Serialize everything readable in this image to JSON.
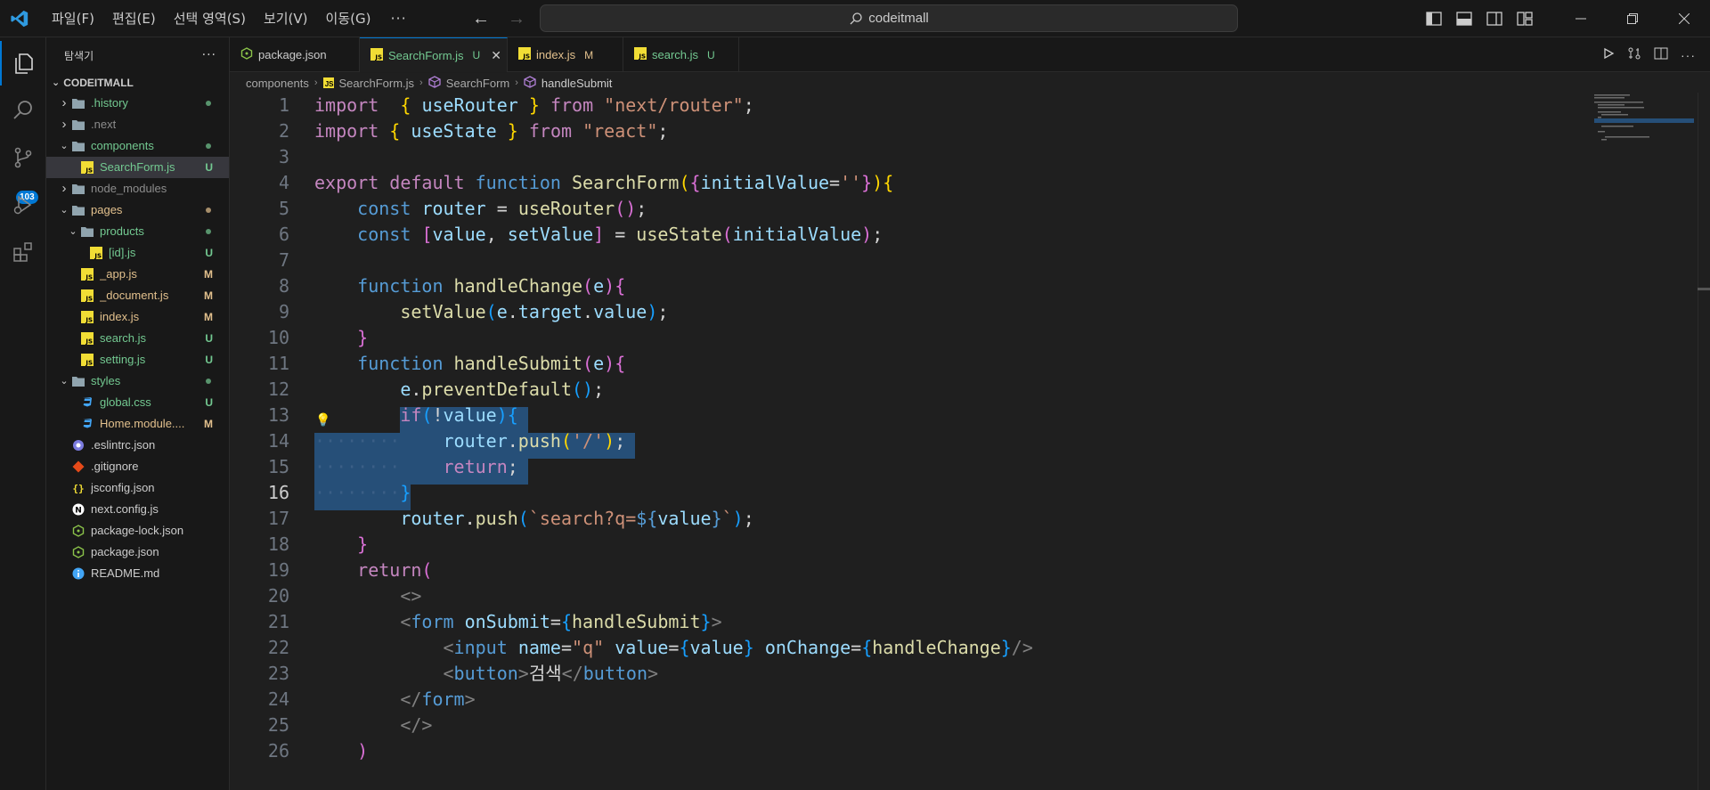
{
  "titlebar": {
    "menu": [
      "파일(F)",
      "편집(E)",
      "선택 영역(S)",
      "보기(V)",
      "이동(G)"
    ],
    "more": "···",
    "search": "codeitmall",
    "nav_back": "←",
    "nav_forward": "→"
  },
  "activity": {
    "scm_badge": "103"
  },
  "sidebar": {
    "title": "탐색기",
    "more": "···",
    "root": "CODEITMALL",
    "items": [
      {
        "label": ".history",
        "kind": "folder",
        "depth": 0,
        "open": false,
        "status": "dot",
        "color": "#73c991"
      },
      {
        "label": ".next",
        "kind": "folder",
        "depth": 0,
        "open": false,
        "status": "",
        "color": "#8c8c8c"
      },
      {
        "label": "components",
        "kind": "folder",
        "depth": 0,
        "open": true,
        "status": "dot",
        "color": "#73c991"
      },
      {
        "label": "SearchForm.js",
        "kind": "js",
        "depth": 1,
        "status": "U",
        "color": "#73c991",
        "selected": true
      },
      {
        "label": "node_modules",
        "kind": "folder",
        "depth": 0,
        "open": false,
        "status": "",
        "color": "#8c8c8c"
      },
      {
        "label": "pages",
        "kind": "folder",
        "depth": 0,
        "open": true,
        "status": "dot",
        "color": "#e2c08d"
      },
      {
        "label": "products",
        "kind": "folder",
        "depth": 1,
        "open": true,
        "status": "dot",
        "color": "#73c991"
      },
      {
        "label": "[id].js",
        "kind": "js",
        "depth": 2,
        "status": "U",
        "color": "#73c991"
      },
      {
        "label": "_app.js",
        "kind": "js",
        "depth": 1,
        "status": "M",
        "color": "#e2c08d"
      },
      {
        "label": "_document.js",
        "kind": "js",
        "depth": 1,
        "status": "M",
        "color": "#e2c08d"
      },
      {
        "label": "index.js",
        "kind": "js",
        "depth": 1,
        "status": "M",
        "color": "#e2c08d"
      },
      {
        "label": "search.js",
        "kind": "js",
        "depth": 1,
        "status": "U",
        "color": "#73c991"
      },
      {
        "label": "setting.js",
        "kind": "js",
        "depth": 1,
        "status": "U",
        "color": "#73c991"
      },
      {
        "label": "styles",
        "kind": "folder",
        "depth": 0,
        "open": true,
        "status": "dot",
        "color": "#73c991"
      },
      {
        "label": "global.css",
        "kind": "css",
        "depth": 1,
        "status": "U",
        "color": "#73c991"
      },
      {
        "label": "Home.module....",
        "kind": "css",
        "depth": 1,
        "status": "M",
        "color": "#e2c08d"
      },
      {
        "label": ".eslintrc.json",
        "kind": "eslint",
        "depth": 0,
        "status": "",
        "color": "#cccccc"
      },
      {
        "label": ".gitignore",
        "kind": "git",
        "depth": 0,
        "status": "",
        "color": "#cccccc"
      },
      {
        "label": "jsconfig.json",
        "kind": "json",
        "depth": 0,
        "status": "",
        "color": "#cccccc"
      },
      {
        "label": "next.config.js",
        "kind": "next",
        "depth": 0,
        "status": "",
        "color": "#cccccc"
      },
      {
        "label": "package-lock.json",
        "kind": "npm",
        "depth": 0,
        "status": "",
        "color": "#cccccc"
      },
      {
        "label": "package.json",
        "kind": "npm",
        "depth": 0,
        "status": "",
        "color": "#cccccc"
      },
      {
        "label": "README.md",
        "kind": "info",
        "depth": 0,
        "status": "",
        "color": "#cccccc"
      }
    ]
  },
  "tabs": [
    {
      "label": "package.json",
      "kind": "npm",
      "status": "",
      "color": "#cccccc",
      "active": false
    },
    {
      "label": "SearchForm.js",
      "kind": "js",
      "status": "U",
      "color": "#73c991",
      "active": true
    },
    {
      "label": "index.js",
      "kind": "js",
      "status": "M",
      "color": "#e2c08d",
      "active": false
    },
    {
      "label": "search.js",
      "kind": "js",
      "status": "U",
      "color": "#73c991",
      "active": false
    }
  ],
  "breadcrumb": {
    "folder": "components",
    "file": "SearchForm.js",
    "symbol1": "SearchForm",
    "symbol2": "handleSubmit"
  },
  "editor": {
    "current_line": 16,
    "lines": [
      [
        [
          "kw",
          "import"
        ],
        [
          "",
          "  "
        ],
        [
          "b1",
          "{"
        ],
        [
          "",
          " "
        ],
        [
          "var",
          "useRouter"
        ],
        [
          "",
          " "
        ],
        [
          "b1",
          "}"
        ],
        [
          "",
          " "
        ],
        [
          "kw",
          "from"
        ],
        [
          "",
          " "
        ],
        [
          "str",
          "\"next/router\""
        ],
        [
          "",
          ";"
        ]
      ],
      [
        [
          "kw",
          "import"
        ],
        [
          "",
          " "
        ],
        [
          "b1",
          "{"
        ],
        [
          "",
          " "
        ],
        [
          "var",
          "useState"
        ],
        [
          "",
          " "
        ],
        [
          "b1",
          "}"
        ],
        [
          "",
          " "
        ],
        [
          "kw",
          "from"
        ],
        [
          "",
          " "
        ],
        [
          "str",
          "\"react\""
        ],
        [
          "",
          ";"
        ]
      ],
      [],
      [
        [
          "kw",
          "export"
        ],
        [
          "",
          " "
        ],
        [
          "kw",
          "default"
        ],
        [
          "",
          " "
        ],
        [
          "kw2",
          "function"
        ],
        [
          "",
          " "
        ],
        [
          "fn",
          "SearchForm"
        ],
        [
          "b1",
          "("
        ],
        [
          "b2",
          "{"
        ],
        [
          "var",
          "initialValue"
        ],
        [
          "",
          "="
        ],
        [
          "str",
          "''"
        ],
        [
          "b2",
          "}"
        ],
        [
          "b1",
          ")"
        ],
        [
          "b1",
          "{"
        ]
      ],
      [
        [
          "",
          "    "
        ],
        [
          "kw2",
          "const"
        ],
        [
          "",
          " "
        ],
        [
          "var",
          "router"
        ],
        [
          "",
          " = "
        ],
        [
          "fn",
          "useRouter"
        ],
        [
          "b2",
          "()"
        ],
        [
          "",
          ";"
        ]
      ],
      [
        [
          "",
          "    "
        ],
        [
          "kw2",
          "const"
        ],
        [
          "",
          " "
        ],
        [
          "b2",
          "["
        ],
        [
          "var",
          "value"
        ],
        [
          "",
          ", "
        ],
        [
          "var",
          "setValue"
        ],
        [
          "b2",
          "]"
        ],
        [
          "",
          " = "
        ],
        [
          "fn",
          "useState"
        ],
        [
          "b2",
          "("
        ],
        [
          "var",
          "initialValue"
        ],
        [
          "b2",
          ")"
        ],
        [
          "",
          ";"
        ]
      ],
      [],
      [
        [
          "",
          "    "
        ],
        [
          "kw2",
          "function"
        ],
        [
          "",
          " "
        ],
        [
          "fn",
          "handleChange"
        ],
        [
          "b2",
          "("
        ],
        [
          "var",
          "e"
        ],
        [
          "b2",
          ")"
        ],
        [
          "b2",
          "{"
        ]
      ],
      [
        [
          "",
          "        "
        ],
        [
          "fn",
          "setValue"
        ],
        [
          "b3",
          "("
        ],
        [
          "var",
          "e"
        ],
        [
          "",
          "."
        ],
        [
          "var",
          "target"
        ],
        [
          "",
          "."
        ],
        [
          "var",
          "value"
        ],
        [
          "b3",
          ")"
        ],
        [
          "",
          ";"
        ]
      ],
      [
        [
          "",
          "    "
        ],
        [
          "b2",
          "}"
        ]
      ],
      [
        [
          "",
          "    "
        ],
        [
          "kw2",
          "function"
        ],
        [
          "",
          " "
        ],
        [
          "fn",
          "handleSubmit"
        ],
        [
          "b2",
          "("
        ],
        [
          "var",
          "e"
        ],
        [
          "b2",
          ")"
        ],
        [
          "b2",
          "{"
        ]
      ],
      [
        [
          "",
          "        "
        ],
        [
          "var",
          "e"
        ],
        [
          "",
          "."
        ],
        [
          "fn",
          "preventDefault"
        ],
        [
          "b3",
          "()"
        ],
        [
          "",
          ";"
        ]
      ],
      [
        [
          "",
          "        "
        ],
        [
          "kw",
          "if"
        ],
        [
          "b3",
          "("
        ],
        [
          "",
          "!"
        ],
        [
          "var",
          "value"
        ],
        [
          "b3",
          ")"
        ],
        [
          "b3",
          "{"
        ]
      ],
      [
        [
          "ws",
          "········"
        ],
        [
          "",
          "    "
        ],
        [
          "var",
          "router"
        ],
        [
          "",
          "."
        ],
        [
          "fn",
          "push"
        ],
        [
          "b1",
          "("
        ],
        [
          "str",
          "'/'"
        ],
        [
          "b1",
          ")"
        ],
        [
          "",
          ";"
        ]
      ],
      [
        [
          "ws",
          "········"
        ],
        [
          "",
          "    "
        ],
        [
          "kw",
          "return"
        ],
        [
          "",
          ";"
        ]
      ],
      [
        [
          "ws",
          "········"
        ],
        [
          "b3",
          "}"
        ]
      ],
      [
        [
          "",
          "        "
        ],
        [
          "var",
          "router"
        ],
        [
          "",
          "."
        ],
        [
          "fn",
          "push"
        ],
        [
          "b3",
          "("
        ],
        [
          "str",
          "`search?q="
        ],
        [
          "kw2",
          "${"
        ],
        [
          "var",
          "value"
        ],
        [
          "kw2",
          "}"
        ],
        [
          "str",
          "`"
        ],
        [
          "b3",
          ")"
        ],
        [
          "",
          ";"
        ]
      ],
      [
        [
          "",
          "    "
        ],
        [
          "b2",
          "}"
        ]
      ],
      [
        [
          "",
          "    "
        ],
        [
          "kw",
          "return"
        ],
        [
          "b2",
          "("
        ]
      ],
      [
        [
          "",
          "        "
        ],
        [
          "tagb",
          "<>"
        ]
      ],
      [
        [
          "",
          "        "
        ],
        [
          "tagb",
          "<"
        ],
        [
          "tag",
          "form"
        ],
        [
          "",
          " "
        ],
        [
          "attr",
          "onSubmit"
        ],
        [
          "",
          "="
        ],
        [
          "b3",
          "{"
        ],
        [
          "fn",
          "handleSubmit"
        ],
        [
          "b3",
          "}"
        ],
        [
          "tagb",
          ">"
        ]
      ],
      [
        [
          "",
          "            "
        ],
        [
          "tagb",
          "<"
        ],
        [
          "tag",
          "input"
        ],
        [
          "",
          " "
        ],
        [
          "attr",
          "name"
        ],
        [
          "",
          "="
        ],
        [
          "str",
          "\"q\""
        ],
        [
          "",
          " "
        ],
        [
          "attr",
          "value"
        ],
        [
          "",
          "="
        ],
        [
          "b3",
          "{"
        ],
        [
          "var",
          "value"
        ],
        [
          "b3",
          "}"
        ],
        [
          "",
          " "
        ],
        [
          "attr",
          "onChange"
        ],
        [
          "",
          "="
        ],
        [
          "b3",
          "{"
        ],
        [
          "fn",
          "handleChange"
        ],
        [
          "b3",
          "}"
        ],
        [
          "tagb",
          "/>"
        ]
      ],
      [
        [
          "",
          "            "
        ],
        [
          "tagb",
          "<"
        ],
        [
          "tag",
          "button"
        ],
        [
          "tagb",
          ">"
        ],
        [
          "",
          "검색"
        ],
        [
          "tagb",
          "</"
        ],
        [
          "tag",
          "button"
        ],
        [
          "tagb",
          ">"
        ]
      ],
      [
        [
          "",
          "        "
        ],
        [
          "tagb",
          "</"
        ],
        [
          "tag",
          "form"
        ],
        [
          "tagb",
          ">"
        ]
      ],
      [
        [
          "",
          "        "
        ],
        [
          "tagb",
          "</>"
        ]
      ],
      [
        [
          "",
          "    "
        ],
        [
          "b2",
          ")"
        ]
      ]
    ]
  },
  "colors": {
    "accent": "#0078d4",
    "selection": "#264f78",
    "untracked": "#73c991",
    "modified": "#e2c08d"
  }
}
